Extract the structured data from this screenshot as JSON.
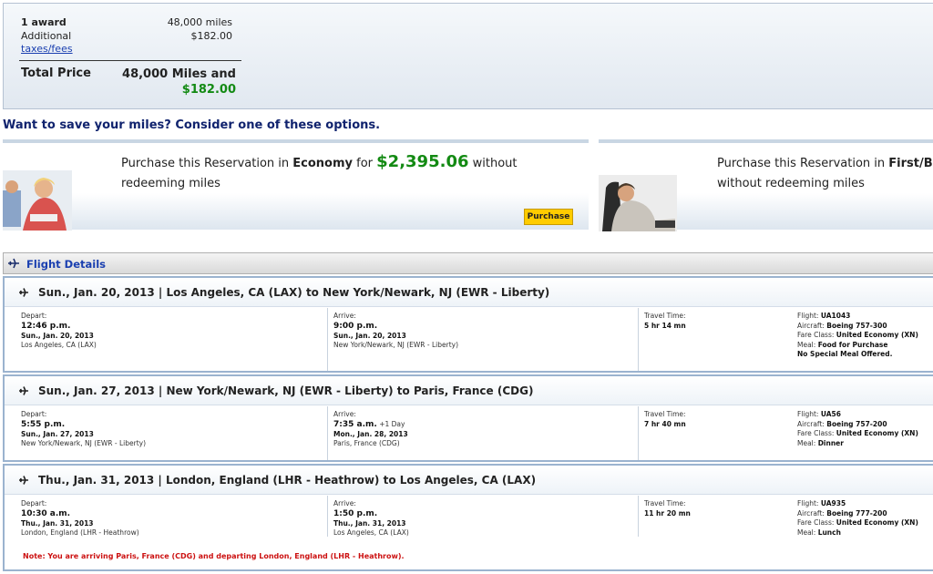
{
  "summary": {
    "award_label": "1 award",
    "award_value": "48,000 miles",
    "additional_label": "Additional",
    "taxes_link": "taxes/fees",
    "taxes_value": "$182.00",
    "total_label": "Total Price",
    "total_miles": "48,000 Miles and",
    "total_cash": "$182.00"
  },
  "save_heading": "Want to save your miles? Consider one of these options.",
  "option_economy": {
    "pre": "Purchase this Reservation in ",
    "cabin": "Economy",
    "for": " for ",
    "price": "$2,395.06",
    "post": " without redeeming miles",
    "button": "Purchase"
  },
  "option_first": {
    "pre": "Purchase this Reservation in ",
    "cabin": "First/B",
    "post": "without redeeming miles"
  },
  "flight_details_title": "Flight Details",
  "segments": [
    {
      "title": "Sun., Jan. 20, 2013 | Los Angeles, CA (LAX) to New York/Newark, NJ (EWR - Liberty)",
      "depart_label": "Depart:",
      "depart_time": "12:46 p.m.",
      "depart_date": "Sun., Jan. 20, 2013",
      "depart_city": "Los Angeles, CA (LAX)",
      "arrive_label": "Arrive:",
      "arrive_time": "9:00 p.m.",
      "arrive_extra": "",
      "arrive_date": "Sun., Jan. 20, 2013",
      "arrive_city": "New York/Newark, NJ (EWR - Liberty)",
      "travel_label": "Travel Time:",
      "travel_time": "5 hr 14 mn",
      "flight_label": "Flight: ",
      "flight": "UA1043",
      "aircraft_label": "Aircraft: ",
      "aircraft": "Boeing 757-300",
      "fare_label": "Fare Class: ",
      "fare": "United Economy (XN)",
      "meal_label": "Meal: ",
      "meal": "Food for Purchase",
      "special": "No Special Meal Offered."
    },
    {
      "title": "Sun., Jan. 27, 2013 | New York/Newark, NJ (EWR - Liberty) to Paris, France (CDG)",
      "depart_label": "Depart:",
      "depart_time": "5:55 p.m.",
      "depart_date": "Sun., Jan. 27, 2013",
      "depart_city": "New York/Newark, NJ (EWR - Liberty)",
      "arrive_label": "Arrive:",
      "arrive_time": "7:35 a.m.",
      "arrive_extra": " +1 Day",
      "arrive_date": "Mon., Jan. 28, 2013",
      "arrive_city": "Paris, France (CDG)",
      "travel_label": "Travel Time:",
      "travel_time": "7 hr 40 mn",
      "flight_label": "Flight: ",
      "flight": "UA56",
      "aircraft_label": "Aircraft: ",
      "aircraft": "Boeing 757-200",
      "fare_label": "Fare Class: ",
      "fare": "United Economy (XN)",
      "meal_label": "Meal: ",
      "meal": "Dinner",
      "special": ""
    },
    {
      "title": "Thu., Jan. 31, 2013 | London, England (LHR - Heathrow) to Los Angeles, CA (LAX)",
      "depart_label": "Depart:",
      "depart_time": "10:30 a.m.",
      "depart_date": "Thu., Jan. 31, 2013",
      "depart_city": "London, England (LHR - Heathrow)",
      "arrive_label": "Arrive:",
      "arrive_time": "1:50 p.m.",
      "arrive_extra": "",
      "arrive_date": "Thu., Jan. 31, 2013",
      "arrive_city": "Los Angeles, CA (LAX)",
      "travel_label": "Travel Time:",
      "travel_time": "11 hr 20 mn",
      "flight_label": "Flight: ",
      "flight": "UA935",
      "aircraft_label": "Aircraft: ",
      "aircraft": "Boeing 777-200",
      "fare_label": "Fare Class: ",
      "fare": "United Economy (XN)",
      "meal_label": "Meal: ",
      "meal": "Lunch",
      "special": ""
    }
  ],
  "note": "Note: You are arriving Paris, France (CDG) and departing London, England (LHR - Heathrow).",
  "colors": {
    "accent_blue": "#10236e",
    "link_blue": "#1a3fb0",
    "price_green": "#138a13",
    "warning_red": "#cc1111",
    "button_yellow": "#ffcc00"
  }
}
